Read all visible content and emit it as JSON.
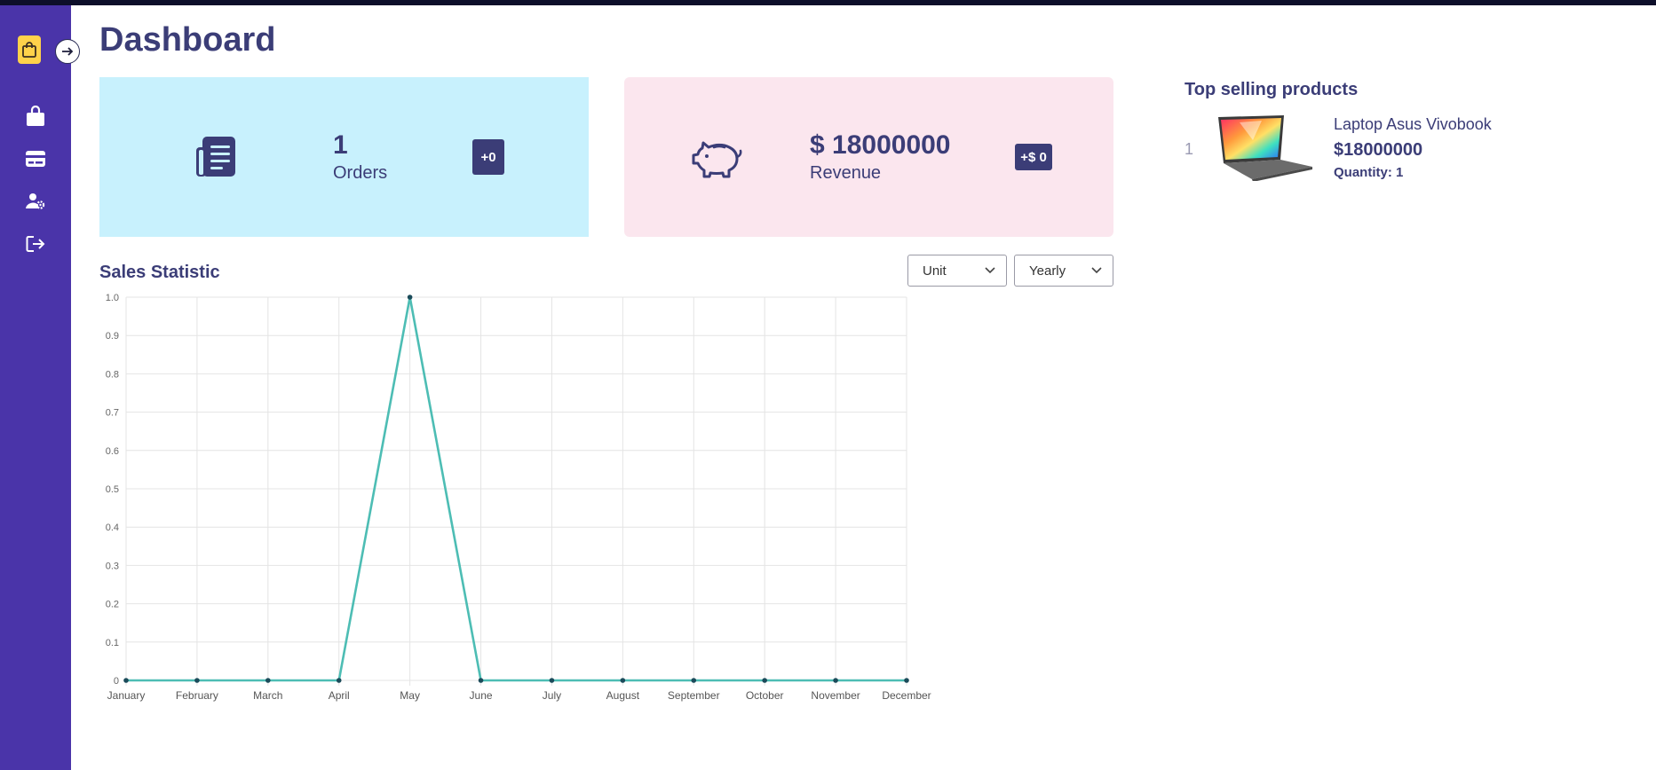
{
  "page": {
    "title": "Dashboard"
  },
  "sidebar": {
    "items": [
      {
        "icon": "shopping-bag-icon"
      },
      {
        "icon": "credit-card-icon"
      },
      {
        "icon": "user-settings-icon"
      },
      {
        "icon": "logout-icon"
      }
    ],
    "logo_icon": "shopping-bag-icon",
    "toggle_icon": "arrow-right-icon"
  },
  "cards": {
    "orders": {
      "value": "1",
      "label": "Orders",
      "badge": "+0",
      "icon": "document-list-icon"
    },
    "revenue": {
      "value": "$ 18000000",
      "label": "Revenue",
      "badge": "+$ 0",
      "icon": "piggy-bank-icon"
    }
  },
  "sales": {
    "title": "Sales Statistic",
    "filters": {
      "metric": "Unit",
      "period": "Yearly"
    }
  },
  "top_products": {
    "title": "Top selling products",
    "items": [
      {
        "rank": "1",
        "name": "Laptop Asus Vivobook",
        "price": "$18000000",
        "quantity": "Quantity: 1"
      }
    ]
  },
  "colors": {
    "sidebar": "#4a34a9",
    "accent": "#3b3d77",
    "orders_card": "#c8f1fd",
    "revenue_card": "#fbe6ee",
    "line": "#4dbdb4"
  },
  "chart_data": {
    "type": "line",
    "title": "Sales Statistic",
    "categories": [
      "January",
      "February",
      "March",
      "April",
      "May",
      "June",
      "July",
      "August",
      "September",
      "October",
      "November",
      "December"
    ],
    "series": [
      {
        "values": [
          0,
          0,
          0,
          0,
          1,
          0,
          0,
          0,
          0,
          0,
          0,
          0
        ]
      }
    ],
    "ylim": [
      0,
      1
    ],
    "yticks": [
      "0",
      "0.1",
      "0.2",
      "0.3",
      "0.4",
      "0.5",
      "0.6",
      "0.7",
      "0.8",
      "0.9",
      "1.0"
    ],
    "grid": true,
    "xlabel": "",
    "ylabel": ""
  }
}
